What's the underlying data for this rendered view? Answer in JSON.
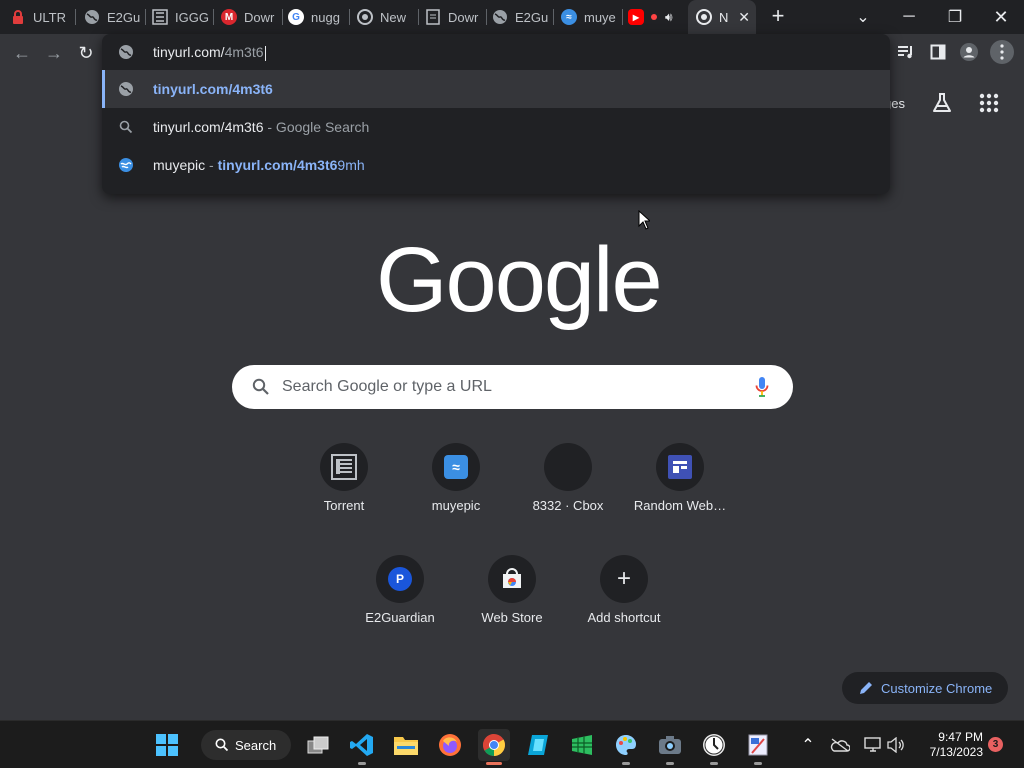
{
  "tabs": [
    {
      "title": "ULTR",
      "icon": "lock-icon",
      "color": "#e03c3c"
    },
    {
      "title": "E2Gu",
      "icon": "globe-icon",
      "color": "#9aa0a6"
    },
    {
      "title": "IGGG",
      "icon": "igg-icon",
      "color": "#bdc1c6"
    },
    {
      "title": "Dowr",
      "icon": "mega-icon",
      "color": "#d9272e"
    },
    {
      "title": "nugg",
      "icon": "google-icon",
      "color": "#ffffff"
    },
    {
      "title": "New",
      "icon": "chrome-icon",
      "color": "#bdc1c6"
    },
    {
      "title": "Dowr",
      "icon": "doc-icon",
      "color": "#bdc1c6"
    },
    {
      "title": "E2Gu",
      "icon": "globe-icon",
      "color": "#9aa0a6"
    },
    {
      "title": "muye",
      "icon": "muyepic-icon",
      "color": "#3b8fe3"
    },
    {
      "title": "",
      "icon": "youtube-icon",
      "color": "#ff0000"
    },
    {
      "title": "N",
      "icon": "chrome-icon",
      "color": "#bdc1c6",
      "active": true
    }
  ],
  "omnibox": {
    "typed": "tinyurl.com/",
    "typed_dim": "4m3t6",
    "suggestions": [
      {
        "icon": "globe-icon",
        "main": "tinyurl.com/4m3t6",
        "rest": ""
      },
      {
        "icon": "search-icon",
        "main": "tinyurl.com/4m3t6",
        "rest": " - Google Search"
      },
      {
        "icon": "muyepic-icon",
        "main": "muyepic",
        "sep": " - ",
        "link": "tinyurl.com/4m3t6",
        "tail": "9mh"
      }
    ]
  },
  "header": {
    "images_partial": "ges"
  },
  "logo_text": "Google",
  "search": {
    "placeholder": "Search Google or type a URL"
  },
  "shortcuts": [
    {
      "label": "Torrent",
      "icon": "igg-icon"
    },
    {
      "label": "muyepic",
      "icon": "muyepic-icon"
    },
    {
      "label": "8332 · Cbox",
      "icon": "blank-icon"
    },
    {
      "label": "Random Web…",
      "icon": "window-icon"
    },
    {
      "label": "E2Guardian",
      "icon": "p-icon"
    },
    {
      "label": "Web Store",
      "icon": "webstore-icon"
    },
    {
      "label": "Add shortcut",
      "icon": "plus-icon"
    }
  ],
  "customize_label": "Customize Chrome",
  "taskbar": {
    "search_label": "Search",
    "time": "9:47 PM",
    "date": "7/13/2023",
    "notifications": "3"
  },
  "colors": {
    "accent": "#8ab4f8",
    "background": "#35363a",
    "dropdown": "#202124"
  }
}
